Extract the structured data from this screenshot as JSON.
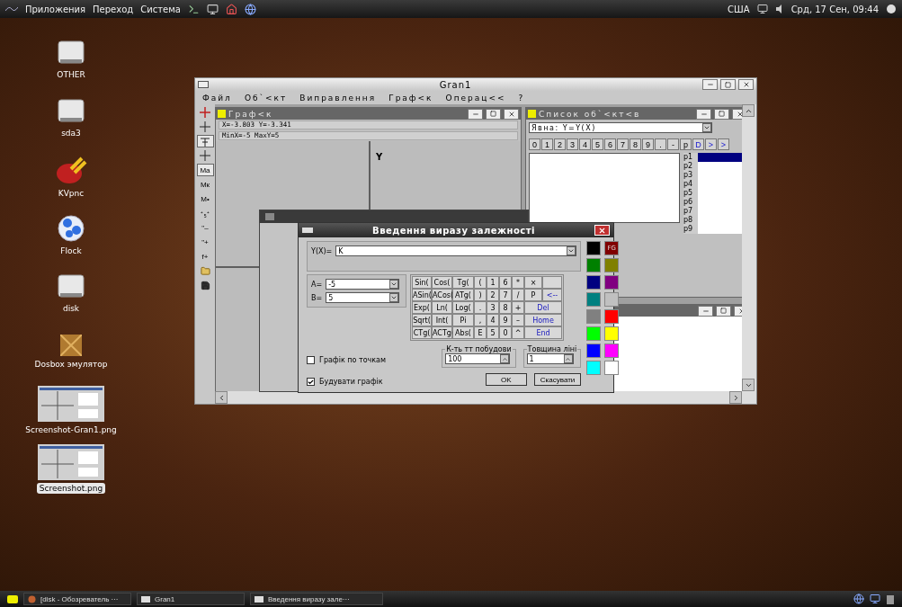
{
  "top_panel": {
    "menus": [
      "Приложения",
      "Переход",
      "Система"
    ],
    "keyboard_layout": "США",
    "clock": "Срд, 17 Сен, 09:44"
  },
  "desktop_icons": [
    {
      "label": "OTHER",
      "kind": "drive",
      "selected": false
    },
    {
      "label": "sda3",
      "kind": "drive",
      "selected": false
    },
    {
      "label": "KVpnc",
      "kind": "plug",
      "selected": false
    },
    {
      "label": "Flock",
      "kind": "globe",
      "selected": false
    },
    {
      "label": "disk",
      "kind": "drive",
      "selected": false
    },
    {
      "label": "Dosbox эмулятор",
      "kind": "dosbox",
      "selected": false
    },
    {
      "label": "Screenshot-Gran1.png",
      "kind": "screenshot",
      "selected": false
    },
    {
      "label": "Screenshot.png",
      "kind": "screenshot",
      "selected": true
    }
  ],
  "main_window": {
    "title": "Gran1",
    "menu": [
      "Файл",
      "Об`<кт",
      "Виправлення",
      "Граф<к",
      "Операц<<",
      "?"
    ],
    "tools": [
      {
        "kind": "cross",
        "pressed": false
      },
      {
        "kind": "plus",
        "pressed": false
      },
      {
        "kind": "tee",
        "pressed": true
      },
      {
        "kind": "plus",
        "pressed": false
      },
      {
        "kind": "text",
        "label": "Mа",
        "pressed": true
      },
      {
        "kind": "text",
        "label": "Mк",
        "pressed": false
      },
      {
        "kind": "text",
        "label": "M•",
        "pressed": false
      },
      {
        "kind": "text",
        "label": "⁺₅⁺",
        "pressed": false
      },
      {
        "kind": "text",
        "label": "\"–",
        "pressed": false
      },
      {
        "kind": "text",
        "label": "\"+",
        "pressed": false
      },
      {
        "kind": "text",
        "label": "f+",
        "pressed": false
      },
      {
        "kind": "folder",
        "pressed": false
      },
      {
        "kind": "save",
        "pressed": false
      }
    ]
  },
  "graph_window": {
    "title": "Граф<к",
    "cursor": "X=-3.803  Y=-3.341",
    "range": "MinX=-5  MaxY=5",
    "axis_label": "Y"
  },
  "list_window": {
    "title": "Список об`<кт<в",
    "mode": "Явна: Y=Y(X)",
    "keys": [
      {
        "label": "0",
        "kind": "char"
      },
      {
        "label": "1",
        "kind": "char"
      },
      {
        "label": "2",
        "kind": "char"
      },
      {
        "label": "3",
        "kind": "char"
      },
      {
        "label": "4",
        "kind": "char"
      },
      {
        "label": "5",
        "kind": "char"
      },
      {
        "label": "6",
        "kind": "char"
      },
      {
        "label": "7",
        "kind": "char"
      },
      {
        "label": "8",
        "kind": "char"
      },
      {
        "label": "9",
        "kind": "char"
      },
      {
        "label": ".",
        "kind": "char"
      },
      {
        "label": "-",
        "kind": "char"
      },
      {
        "label": "p",
        "kind": "char"
      },
      {
        "label": "D",
        "kind": "command"
      },
      {
        "label": ">",
        "kind": "command"
      },
      {
        "label": ">",
        "kind": "command"
      }
    ],
    "points": [
      {
        "label": "p1",
        "selected": true
      },
      {
        "label": "p2",
        "selected": false
      },
      {
        "label": "p3",
        "selected": false
      },
      {
        "label": "p4",
        "selected": false
      },
      {
        "label": "p5",
        "selected": false
      },
      {
        "label": "p6",
        "selected": false
      },
      {
        "label": "p7",
        "selected": false
      },
      {
        "label": "p8",
        "selected": false
      },
      {
        "label": "p9",
        "selected": false
      }
    ]
  },
  "dialog": {
    "title": "Введення виразу залежності",
    "expression_label": "Y(X)=",
    "expression": "K",
    "params": [
      {
        "label": "A=",
        "value": "-5"
      },
      {
        "label": "B=",
        "value": "5"
      }
    ],
    "keys": [
      {
        "label": "Sin(",
        "kind": "func"
      },
      {
        "label": "Cos(",
        "kind": "func"
      },
      {
        "label": "Tg(",
        "kind": "func"
      },
      {
        "label": "(",
        "kind": "char"
      },
      {
        "label": "1",
        "kind": "char"
      },
      {
        "label": "6",
        "kind": "char"
      },
      {
        "label": "*",
        "kind": "char"
      },
      {
        "label": "×",
        "kind": "char"
      },
      {
        "kind": "blank"
      },
      {
        "label": "ASin(",
        "kind": "func"
      },
      {
        "label": "ACos(",
        "kind": "func"
      },
      {
        "label": "ATg(",
        "kind": "func"
      },
      {
        "label": ")",
        "kind": "char"
      },
      {
        "label": "2",
        "kind": "char"
      },
      {
        "label": "7",
        "kind": "char"
      },
      {
        "label": "/",
        "kind": "char"
      },
      {
        "label": "P",
        "kind": "char"
      },
      {
        "label": "<--",
        "kind": "edit"
      },
      {
        "label": "Exp(",
        "kind": "func"
      },
      {
        "label": "Ln(",
        "kind": "func"
      },
      {
        "label": "Log(",
        "kind": "func"
      },
      {
        "label": ".",
        "kind": "char"
      },
      {
        "label": "3",
        "kind": "char"
      },
      {
        "label": "8",
        "kind": "char"
      },
      {
        "label": "+",
        "kind": "char"
      },
      {
        "label": "Del",
        "kind": "nav"
      },
      {
        "label": "Sqrt(",
        "kind": "func"
      },
      {
        "label": "Int(",
        "kind": "func"
      },
      {
        "label": "Pi",
        "kind": "func"
      },
      {
        "label": ",",
        "kind": "char"
      },
      {
        "label": "4",
        "kind": "char"
      },
      {
        "label": "9",
        "kind": "char"
      },
      {
        "label": "–",
        "kind": "char"
      },
      {
        "label": "Home",
        "kind": "nav"
      },
      {
        "label": "CTg(",
        "kind": "func"
      },
      {
        "label": "ACTg(",
        "kind": "func"
      },
      {
        "label": "Abs(",
        "kind": "func"
      },
      {
        "label": "E",
        "kind": "char"
      },
      {
        "label": "5",
        "kind": "char"
      },
      {
        "label": "0",
        "kind": "char"
      },
      {
        "label": "^",
        "kind": "char"
      },
      {
        "label": "End",
        "kind": "nav"
      }
    ],
    "options": [
      {
        "label": "Графік по точкам",
        "checked": false
      },
      {
        "label": "Будувати графік",
        "checked": true
      }
    ],
    "points_count": {
      "label": "К-ть тт побудови",
      "value": "100"
    },
    "line_width": {
      "label": "Товщина ліні",
      "value": "1"
    },
    "buttons": [
      "OK",
      "Скасувати"
    ],
    "palette": [
      {
        "color": "#000000"
      },
      {
        "color": "#800000",
        "label": "FG"
      },
      {
        "color": "#008000"
      },
      {
        "color": "#808000"
      },
      {
        "color": "#000080"
      },
      {
        "color": "#800080"
      },
      {
        "color": "#008080"
      },
      {
        "color": "#c0c0c0"
      },
      {
        "color": "#808080"
      },
      {
        "color": "#ff0000"
      },
      {
        "color": "#00ff00"
      },
      {
        "color": "#ffff00"
      },
      {
        "color": "#0000ff"
      },
      {
        "color": "#ff00ff"
      },
      {
        "color": "#00ffff"
      },
      {
        "color": "#ffffff"
      }
    ]
  },
  "taskbar": {
    "items": [
      {
        "label": "[disk - Обозреватель ···",
        "kind": "browser"
      },
      {
        "label": "Gran1",
        "kind": "window"
      },
      {
        "label": "Введення виразу зале···",
        "kind": "window"
      }
    ]
  }
}
